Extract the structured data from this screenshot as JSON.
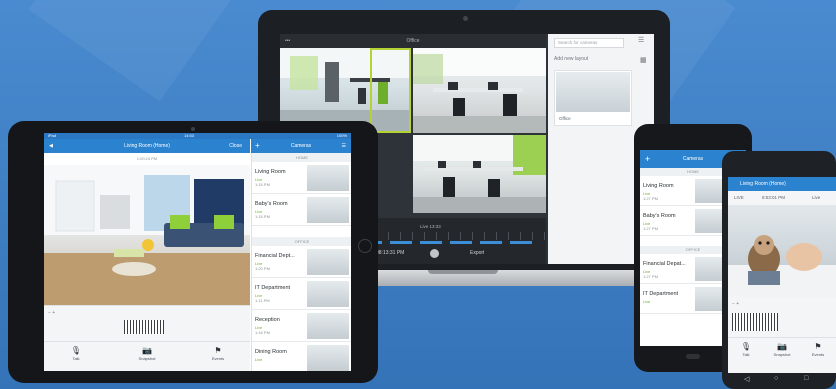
{
  "laptop": {
    "window_title": "Office",
    "menu_dots": "•••",
    "search_placeholder": "Search for cameras",
    "add_layout": "Add new layout",
    "layout_name": "Office",
    "live_label": "Live 13:33",
    "timeline_time": "08:13:31 PM",
    "clock": "02:53",
    "export_label": "Export"
  },
  "tablet": {
    "status_carrier": "iPad",
    "status_time": "14:53",
    "status_battery": "100%",
    "back_label": "Living Room (Home)",
    "close_label": "Close",
    "date_label": "1:00:24 PM",
    "cameras_title": "Cameras",
    "home_section": "HOME",
    "office_section": "OFFICE",
    "cameras": [
      {
        "name": "Living Room",
        "live": "Live",
        "time": "1:15 PM"
      },
      {
        "name": "Baby's Room",
        "live": "Live",
        "time": "1:15 PM"
      },
      {
        "name": "Financial Dept...",
        "live": "Live",
        "time": "1:20 PM"
      },
      {
        "name": "IT Department",
        "live": "Live",
        "time": "1:11 PM"
      },
      {
        "name": "Reception",
        "live": "Live",
        "time": "1:16 PM"
      },
      {
        "name": "Dining Room",
        "live": "Live",
        "time": ""
      }
    ],
    "footer": [
      {
        "icon": "mic-icon",
        "label": "Talk"
      },
      {
        "icon": "camera-icon",
        "label": "Snapshot"
      },
      {
        "icon": "flag-icon",
        "label": "Events"
      }
    ]
  },
  "phone": {
    "title": "Cameras",
    "home_section": "HOME",
    "office_section": "OFFICE",
    "cameras": [
      {
        "name": "Living Room",
        "live": "Live",
        "time": "1:27 PM"
      },
      {
        "name": "Baby's Room",
        "live": "Live",
        "time": "1:27 PM"
      },
      {
        "name": "Financial Depat...",
        "live": "Live",
        "time": "1:27 PM"
      },
      {
        "name": "IT Department",
        "live": "Live",
        "time": ""
      }
    ]
  },
  "android": {
    "title": "Living Room (Home)",
    "tabs": [
      "LIVE",
      "8:53:01 PM",
      "Live"
    ],
    "footer": [
      {
        "icon": "mic-icon",
        "label": "Talk"
      },
      {
        "icon": "camera-icon",
        "label": "Snapshot"
      },
      {
        "icon": "flag-icon",
        "label": "Events"
      }
    ]
  },
  "colors": {
    "background": "#3f7fc4",
    "accent": "#2b82cf",
    "highlight": "#b5d334"
  }
}
